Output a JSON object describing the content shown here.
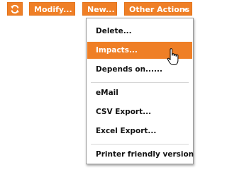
{
  "toolbar": {
    "refresh_icon": "refresh-icon",
    "modify_label": "Modify...",
    "new_label": "New...",
    "other_actions_label": "Other Actions",
    "accent_color": "#ef7f26"
  },
  "menu": {
    "items": [
      {
        "label": "Delete...",
        "highlighted": false
      },
      {
        "label": "Impacts...",
        "highlighted": true
      },
      {
        "label": "Depends on......",
        "highlighted": false
      },
      {
        "label": "eMail",
        "highlighted": false
      },
      {
        "label": "CSV Export...",
        "highlighted": false
      },
      {
        "label": "Excel Export...",
        "highlighted": false
      },
      {
        "label": "Printer friendly version",
        "highlighted": false
      }
    ]
  },
  "cursor_icon": "hand-pointer-icon"
}
